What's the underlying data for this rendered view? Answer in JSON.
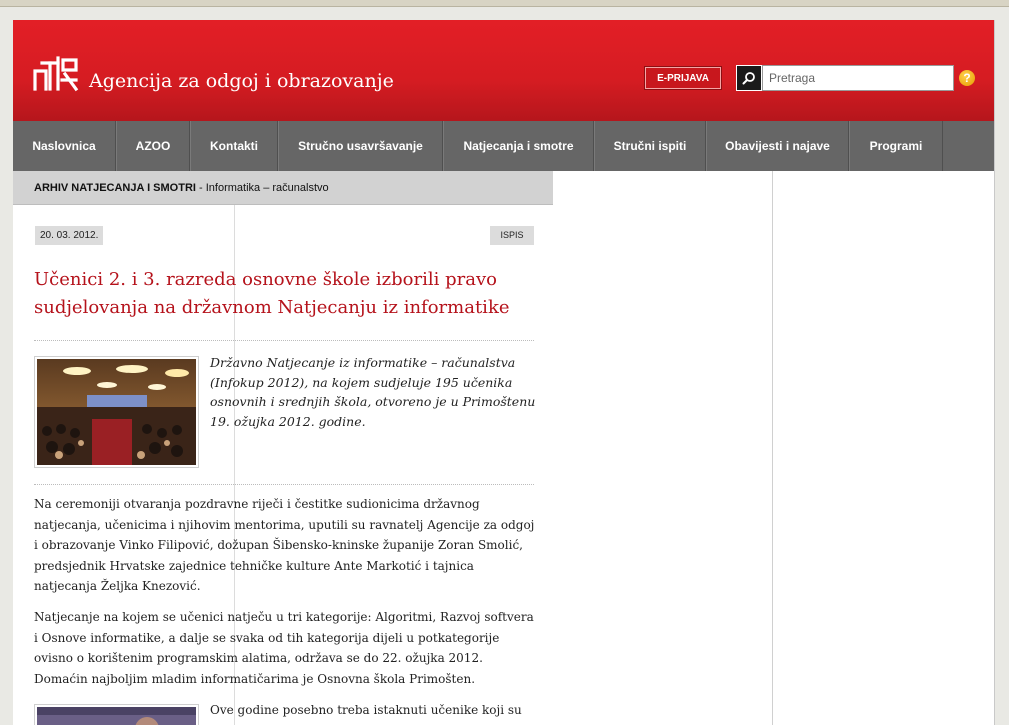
{
  "header": {
    "site_title": "Agencija za odgoj i obrazovanje",
    "eprijava_label": "E-PRIJAVA",
    "search_placeholder": "Pretraga",
    "help_label": "?",
    "colors": {
      "brand_red": "#d51c22",
      "nav_gray": "#666666",
      "title_red": "#b5121b"
    }
  },
  "nav": {
    "items": [
      {
        "label": "Naslovnica"
      },
      {
        "label": "AZOO"
      },
      {
        "label": "Kontakti"
      },
      {
        "label": "Stručno usavršavanje"
      },
      {
        "label": "Natjecanja i smotre"
      },
      {
        "label": "Stručni ispiti"
      },
      {
        "label": "Obavijesti i najave"
      },
      {
        "label": "Programi"
      }
    ]
  },
  "breadcrumb": {
    "section": "ARHIV NATJECANJA I SMOTRI",
    "separator": " - ",
    "current": "Informatika – računalstvo"
  },
  "article": {
    "date": "20. 03. 2012.",
    "print_label": "ISPIS",
    "title": "Učenici 2. i 3. razreda osnovne škole izborili pravo sudjelovanja na državnom Natjecanju iz informatike",
    "lead": "Državno Natjecanje iz informatike – računalstva (Infokup 2012), na kojem sudjeluje 195 učenika osnovnih i srednjih škola, otvoreno je u Primoštenu 19. ožujka 2012. godine.",
    "paragraphs": [
      "Na ceremoniji otvaranja pozdravne riječi i čestitke sudionicima državnog natjecanja, učenicima i njihovim mentorima, uputili su ravnatelj Agencije za odgoj i obrazovanje Vinko Filipović, dožupan Šibensko-kninske županije Zoran Smolić, predsjednik Hrvatske zajednice tehničke kulture Ante Markotić i tajnica natjecanja Željka Knezović.",
      "Natjecanje na kojem se učenici natječu u tri kategorije: Algoritmi, Razvoj softvera i Osnove informatike, a dalje se svaka od tih kategorija dijeli u potkategorije ovisno o korištenim programskim alatima, održava se do 22. ožujka 2012. Domaćin najboljim mladim informatičarima je Osnovna škola Primošten.",
      "Ove godine posebno treba istaknuti učenike koji su"
    ]
  }
}
